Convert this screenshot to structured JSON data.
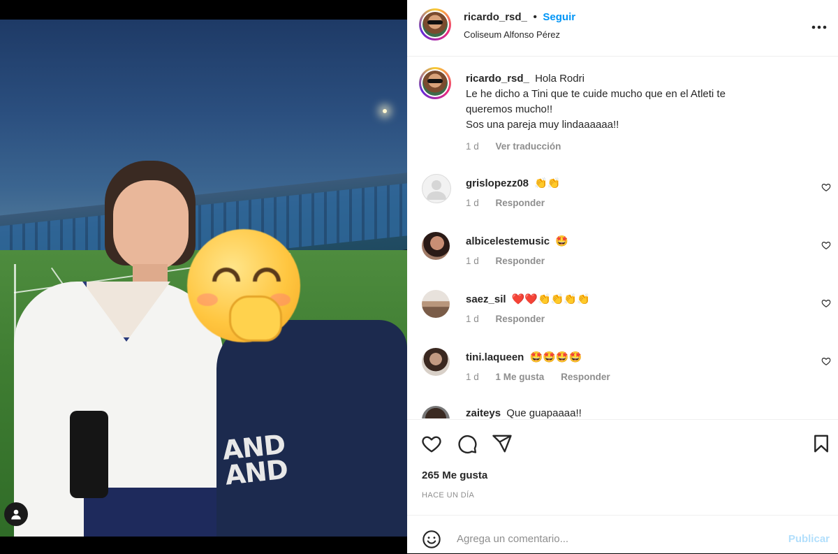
{
  "post": {
    "username": "ricardo_rsd_",
    "separator": "•",
    "follow_label": "Seguir",
    "location": "Coliseum Alfonso Pérez",
    "shirt_print": "AND\nAND"
  },
  "caption": {
    "username": "ricardo_rsd_",
    "text_line1": "Hola Rodri",
    "text_line2": "Le he dicho a Tini que te cuide mucho que en el Atleti te",
    "text_line3": "queremos mucho!!",
    "text_line4": "Sos una pareja muy lindaaaaaa!!",
    "time": "1 d",
    "translate_label": "Ver traducción"
  },
  "comments": [
    {
      "username": "grislopezz08",
      "text": "👏👏",
      "time": "1 d",
      "likes_label": "",
      "reply_label": "Responder"
    },
    {
      "username": "albicelestemusic",
      "text": "🤩",
      "time": "1 d",
      "likes_label": "",
      "reply_label": "Responder"
    },
    {
      "username": "saez_sil",
      "text": "❤️❤️👏👏👏👏",
      "time": "1 d",
      "likes_label": "",
      "reply_label": "Responder"
    },
    {
      "username": "tini.laqueen",
      "text": "🤩🤩🤩🤩",
      "time": "1 d",
      "likes_label": "1 Me gusta",
      "reply_label": "Responder"
    },
    {
      "username": "zaiteys",
      "text": "Que guapaaaa!!",
      "time": "",
      "likes_label": "",
      "reply_label": ""
    }
  ],
  "actions": {
    "likes_text": "265 Me gusta",
    "date_text": "HACE UN DÍA"
  },
  "add_comment": {
    "placeholder": "Agrega un comentario...",
    "publish_label": "Publicar"
  },
  "colors": {
    "accent": "#0095f6",
    "publish_disabled": "#b2dffc",
    "muted": "#8e8e8e"
  },
  "icons": [
    "more-options-icon",
    "heart-icon",
    "comment-icon",
    "share-icon",
    "bookmark-icon",
    "emoji-icon",
    "user-tag-icon"
  ]
}
